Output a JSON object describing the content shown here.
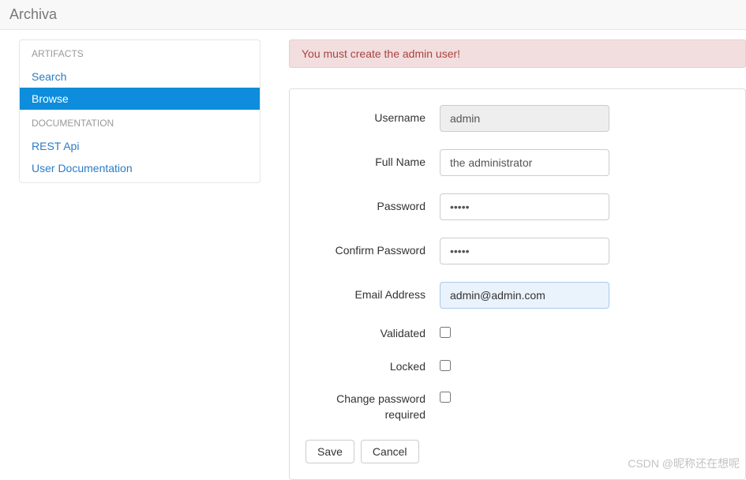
{
  "header": {
    "brand": "Archiva"
  },
  "sidebar": {
    "sections": [
      {
        "title": "ARTIFACTS",
        "items": [
          {
            "label": "Search",
            "active": false
          },
          {
            "label": "Browse",
            "active": true
          }
        ]
      },
      {
        "title": "DOCUMENTATION",
        "items": [
          {
            "label": "REST Api",
            "active": false
          },
          {
            "label": "User Documentation",
            "active": false
          }
        ]
      }
    ]
  },
  "alert": {
    "message": "You must create the admin user!"
  },
  "form": {
    "labels": {
      "username": "Username",
      "fullname": "Full Name",
      "password": "Password",
      "confirm_password": "Confirm Password",
      "email": "Email Address",
      "validated": "Validated",
      "locked": "Locked",
      "change_password_required": "Change password required"
    },
    "values": {
      "username": "admin",
      "fullname": "the administrator",
      "password": "•••••",
      "confirm_password": "•••••",
      "email": "admin@admin.com",
      "validated": false,
      "locked": false,
      "change_password_required": false
    },
    "buttons": {
      "save": "Save",
      "cancel": "Cancel"
    }
  },
  "watermark": "CSDN @昵称还在想呢"
}
